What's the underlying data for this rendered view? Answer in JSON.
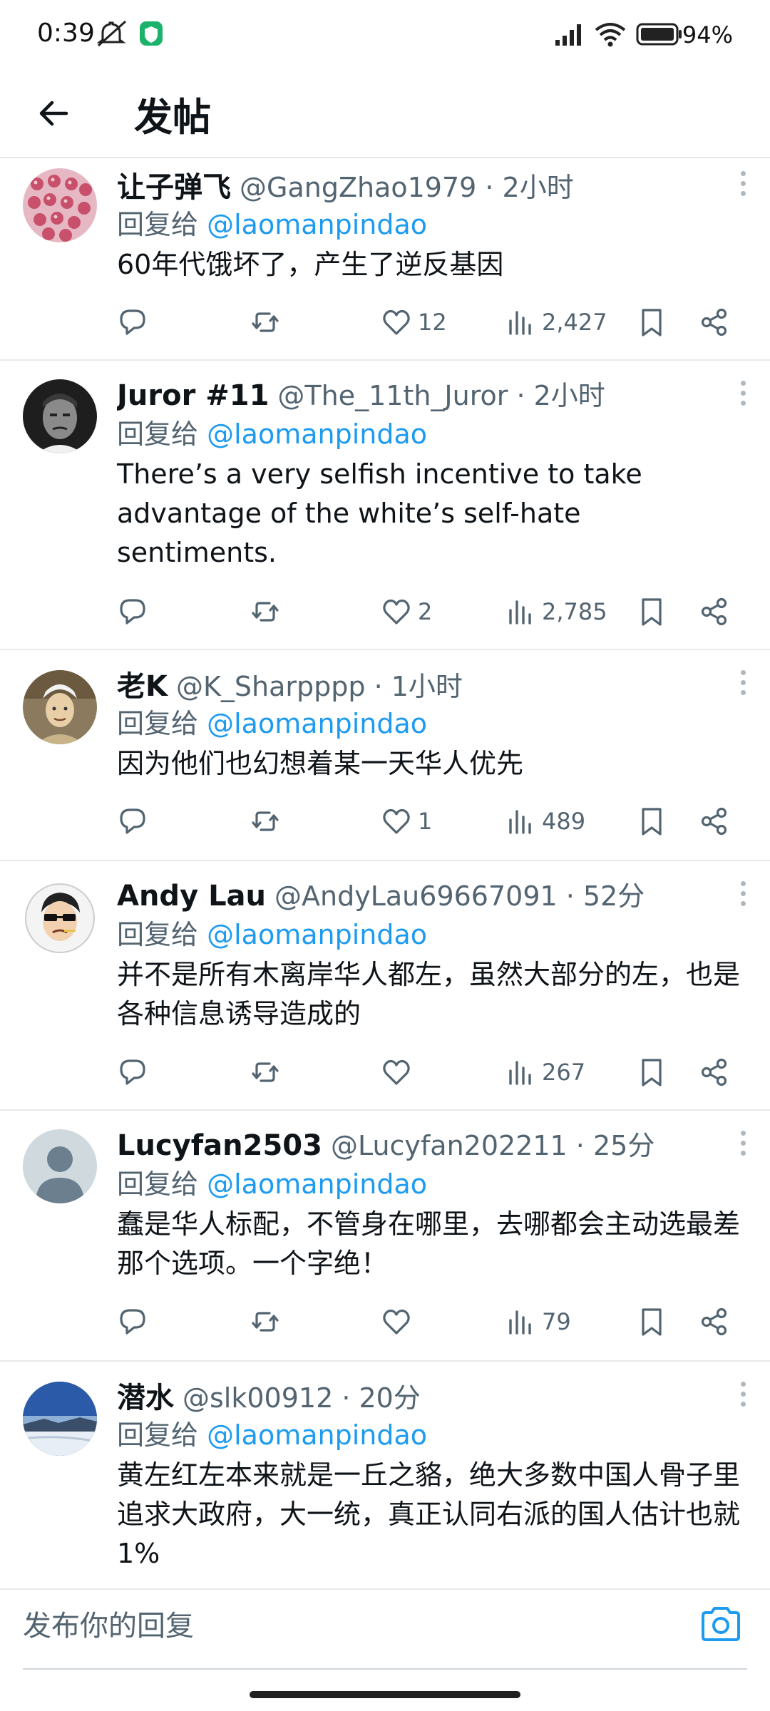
{
  "status_bar": {
    "time": "0:39",
    "battery_percent": "94%"
  },
  "header": {
    "title": "发帖"
  },
  "replies": [
    {
      "display_name": "让子弹飞",
      "handle_time": "@GangZhao1979 · 2小时",
      "reply_prefix": "回复给",
      "reply_to": "@laomanpindao",
      "text": "60年代饿坏了，产生了逆反基因",
      "likes": "12",
      "views": "2,427"
    },
    {
      "display_name": "Juror #11",
      "handle_time": "@The_11th_Juror · 2小时",
      "reply_prefix": "回复给",
      "reply_to": "@laomanpindao",
      "text": "There’s a very selfish incentive to take advantage of the white’s self-hate sentiments.",
      "likes": "2",
      "views": "2,785"
    },
    {
      "display_name": "老K",
      "handle_time": "@K_Sharpppp · 1小时",
      "reply_prefix": "回复给",
      "reply_to": "@laomanpindao",
      "text": "因为他们也幻想着某一天华人优先",
      "likes": "1",
      "views": "489"
    },
    {
      "display_name": "Andy Lau",
      "handle_time": "@AndyLau69667091 · 52分",
      "reply_prefix": "回复给",
      "reply_to": "@laomanpindao",
      "text": "并不是所有木离岸华人都左，虽然大部分的左，也是各种信息诱导造成的",
      "likes": "",
      "views": "267"
    },
    {
      "display_name": "Lucyfan2503",
      "handle_time": "@Lucyfan202211 · 25分",
      "reply_prefix": "回复给",
      "reply_to": "@laomanpindao",
      "text": "蠢是华人标配，不管身在哪里，去哪都会主动选最差那个选项。一个字绝！",
      "likes": "",
      "views": "79"
    },
    {
      "display_name": "潜水",
      "handle_time": "@slk00912 · 20分",
      "reply_prefix": "回复给",
      "reply_to": "@laomanpindao",
      "text": "黄左红左本来就是一丘之貉，绝大多数中国人骨子里追求大政府，大一统，真正认同右派的国人估计也就1%",
      "likes": "",
      "views": ""
    }
  ],
  "composer": {
    "placeholder": "发布你的回复"
  },
  "icons": {
    "back": "arrow-left-icon",
    "reply": "reply-bubble-icon",
    "repost": "repost-icon",
    "like": "heart-icon",
    "views": "views-bar-chart-icon",
    "bookmark": "bookmark-icon",
    "share": "share-icon",
    "more": "more-vertical-icon",
    "camera": "camera-icon"
  },
  "colors": {
    "accent": "#1d9bf0",
    "text": "#0f1419",
    "secondary": "#536471"
  }
}
